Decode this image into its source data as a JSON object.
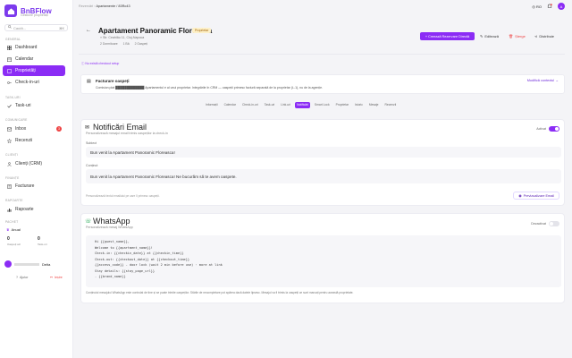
{
  "brand": {
    "name": "BnBFlow",
    "tagline": "Gestiune proprietăți"
  },
  "search": {
    "placeholder": "Caută...",
    "shortcut": "⌘K"
  },
  "sidebar": {
    "sections": {
      "general": "GENERAL",
      "tasks": "TASK-URI",
      "communication": "COMUNICARE",
      "clients": "CLIENȚI",
      "finance": "FINANȚE",
      "reports": "RAPOARTE",
      "plan": "PACHET"
    },
    "items": [
      {
        "label": "Dashboard"
      },
      {
        "label": "Calendar"
      },
      {
        "label": "Proprietăți"
      },
      {
        "label": "Check-in-uri"
      },
      {
        "label": "Task-uri"
      },
      {
        "label": "Inbox",
        "badge": "3"
      },
      {
        "label": "Recenzii"
      },
      {
        "label": "Clienți (CRM)"
      },
      {
        "label": "Facturare"
      },
      {
        "label": "Rapoarte"
      }
    ],
    "plan": {
      "name": "Anual",
      "stat1_value": "0",
      "stat1_label": "Oaspeți azi",
      "stat2_value": "0",
      "stat2_label": "Task-uri"
    },
    "user": {
      "name": "Delta"
    },
    "bottom": {
      "help": "Ajutor",
      "logout": "Ieșire"
    }
  },
  "breadcrumb": {
    "parent": "Rezervări",
    "current": "Apartamente / 83Ro43"
  },
  "topbar": {
    "lang": "RO",
    "avatar": "A"
  },
  "property": {
    "title": "Apartament Panoramic Floreasca",
    "badge": "Proprietar",
    "address": "Str. Ceahlău 11, Cluj-Napoca",
    "meta": [
      "2 Dormitoare",
      "1 Bă",
      "2 Oaspeți"
    ]
  },
  "actions": {
    "create": "+ Creează Rezervare Directă",
    "edit": "Editează",
    "delete": "Șterge",
    "share": "Distribuie"
  },
  "message_note": "Nu există checkout setup",
  "notice": {
    "title": "Facturare oaspeți",
    "text": "Comision plat █████████████ Apartamentul e al unui proprietar. Integrările în CRM — oaspeții primesc factură separată de la proprietar (L-1), nu de la agenție.",
    "link": "Modifică contextul →"
  },
  "tabs": [
    "Informații",
    "Calendar",
    "Check-in-uri",
    "Task-uri",
    "Link-uri",
    "Notificări",
    "Smart Lock",
    "Proprietar",
    "Istoric",
    "Mesaje",
    "Recenzii"
  ],
  "email": {
    "title": "Notificări Email",
    "subtitle": "Personalizează mesajul email trimis oaspeților la check-in",
    "status": "Activat",
    "subject_label": "Subiect",
    "subject_value": "Bun venit la Apartament Panoramic Floreasca!",
    "content_label": "Conținut",
    "content_value": "Bun venit la Apartament Panoramic Floreasca! Ne bucurăm să te avem oaspete.",
    "hint": "Personalizează textul emailului pe care îl primesc oaspeții.",
    "preview": "Previzualizare Email"
  },
  "whatsapp": {
    "title": "WhatsApp",
    "subtitle": "Personalizează mesaj WhatsApp",
    "status": "Dezactivat",
    "lines": [
      "Hi {{guest_name}},",
      "Welcome to {{apartment_name}}!",
      "Check-in: {{checkin_date}} at {{checkin_time}}",
      "Check-out: {{checkout_date}} at {{checkout_time}}",
      "{{access_code}} - door lock (wait 2 min before use) · more at link",
      "Stay details: {{stay_page_url}}",
      "- {{brand_name}}"
    ],
    "note": "Conținutul mesajului WhatsApp este controlat de tine și se poate trimite oaspeților. Stările de necompletare pot apărea dacă datele lipsesc. Mesajul va fi trimis la oaspeții ce sunt marcați pentru această proprietate."
  },
  "colors": {
    "accent": "#8b2cf5",
    "danger": "#ef4444"
  }
}
